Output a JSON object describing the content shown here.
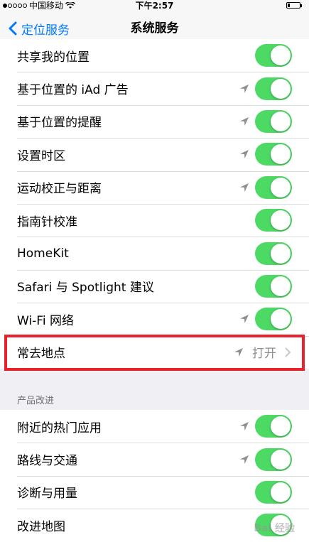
{
  "status_bar": {
    "carrier": "中国移动",
    "time": "下午2:57"
  },
  "nav": {
    "back_label": "定位服务",
    "title": "系统服务"
  },
  "list1": [
    {
      "label": "共享我的位置",
      "location_arrow": false,
      "on": true
    },
    {
      "label": "基于位置的 iAd 广告",
      "location_arrow": true,
      "on": true
    },
    {
      "label": "基于位置的提醒",
      "location_arrow": true,
      "on": true
    },
    {
      "label": "设置时区",
      "location_arrow": true,
      "on": true
    },
    {
      "label": "运动校正与距离",
      "location_arrow": true,
      "on": true
    },
    {
      "label": "指南针校准",
      "location_arrow": false,
      "on": true
    },
    {
      "label": "HomeKit",
      "location_arrow": false,
      "on": true
    },
    {
      "label": "Safari 与 Spotlight 建议",
      "location_arrow": false,
      "on": true
    },
    {
      "label": "Wi-Fi 网络",
      "location_arrow": true,
      "on": true
    },
    {
      "label": "常去地点",
      "location_arrow": true,
      "value": "打开"
    }
  ],
  "section_header": "产品改进",
  "list2": [
    {
      "label": "附近的热门应用",
      "location_arrow": true,
      "on": true
    },
    {
      "label": "路线与交通",
      "location_arrow": true,
      "on": true
    },
    {
      "label": "诊断与用量",
      "location_arrow": false,
      "on": true
    },
    {
      "label": "改进地图",
      "location_arrow": false,
      "on": true
    }
  ],
  "watermark": "Bai 经验",
  "colors": {
    "accent": "#007aff",
    "toggle_on": "#4cd964",
    "highlight": "#e8222b",
    "background": "#efeff4"
  }
}
